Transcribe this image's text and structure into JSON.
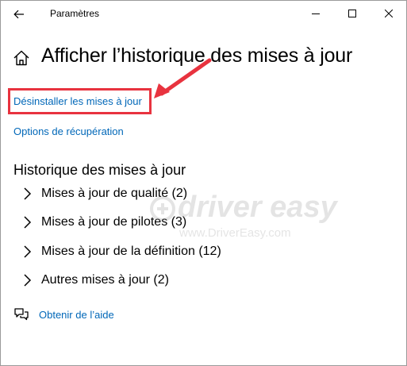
{
  "window": {
    "app_title": "Paramètres",
    "icons": {
      "back": "back-arrow-icon",
      "minimize": "minimize-icon",
      "maximize": "maximize-icon",
      "close": "close-icon"
    }
  },
  "header": {
    "home_icon": "home-icon",
    "title": "Afficher l’historique des mises à jour"
  },
  "links": {
    "uninstall": "Désinstaller les mises à jour",
    "recovery": "Options de récupération"
  },
  "annotation": {
    "highlight_color": "#e8333f"
  },
  "history": {
    "title": "Historique des mises à jour",
    "items": [
      {
        "label": "Mises à jour de qualité (2)"
      },
      {
        "label": "Mises à jour de pilotes (3)"
      },
      {
        "label": "Mises à jour de la définition (12)"
      },
      {
        "label": "Autres mises à jour (2)"
      }
    ]
  },
  "help": {
    "label": "Obtenir de l’aide",
    "icon": "chat-help-icon"
  },
  "watermark": {
    "main": "driver easy",
    "sub": "www.DriverEasy.com"
  },
  "colors": {
    "link": "#0067b8",
    "text": "#000000",
    "background": "#ffffff"
  }
}
